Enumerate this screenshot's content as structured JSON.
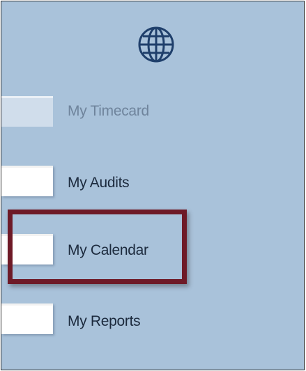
{
  "nav": {
    "items": [
      {
        "label": "My Timecard",
        "state": "disabled"
      },
      {
        "label": "My Audits",
        "state": "normal"
      },
      {
        "label": "My Calendar",
        "state": "highlighted"
      },
      {
        "label": "My Reports",
        "state": "normal"
      }
    ]
  },
  "icons": {
    "top": "globe-icon"
  },
  "colors": {
    "panel_background": "#a9c2da",
    "globe": "#1f3f6b",
    "highlight_border": "#6e1a27",
    "label_text": "#1c2a3d",
    "label_disabled": "#6f849c"
  }
}
